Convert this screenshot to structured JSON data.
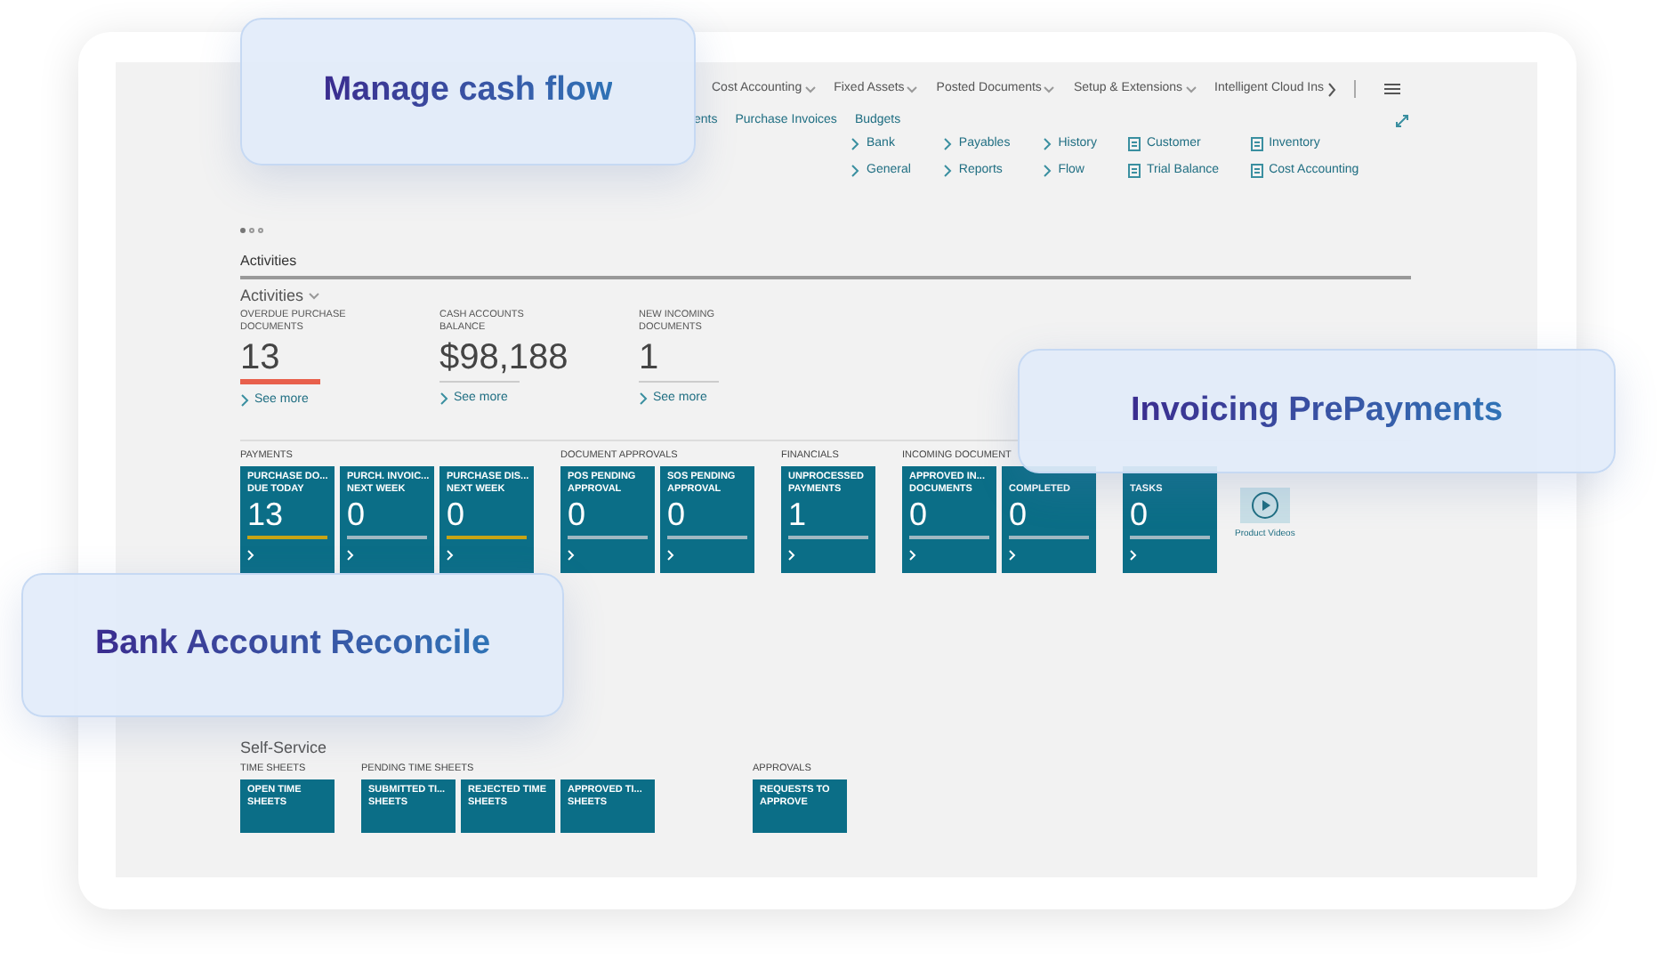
{
  "nav": {
    "menus": [
      "Cost Accounting",
      "Fixed Assets",
      "Posted Documents",
      "Setup & Extensions"
    ],
    "overflow_menu": "Intelligent Cloud Ins"
  },
  "actions": [
    "ents",
    "Purchase Invoices",
    "Budgets"
  ],
  "link_columns": [
    {
      "kind": "chevron",
      "links": [
        "Bank",
        "General"
      ]
    },
    {
      "kind": "chevron",
      "links": [
        "Payables",
        "Reports"
      ]
    },
    {
      "kind": "chevron",
      "links": [
        "History",
        "Flow"
      ]
    },
    {
      "kind": "report",
      "links": [
        "Customer",
        "Trial Balance"
      ]
    },
    {
      "kind": "report",
      "links": [
        "Inventory",
        "Cost Accounting"
      ]
    }
  ],
  "carousel": [
    {
      "selected": true
    },
    {
      "selected": false
    },
    {
      "selected": false
    }
  ],
  "section_title": "Activities",
  "activities": {
    "title": "Activities",
    "kpis": [
      {
        "label": "OVERDUE PURCHASE DOCUMENTS",
        "value": "13",
        "alert": true,
        "link": "See more"
      },
      {
        "label": "CASH ACCOUNTS BALANCE",
        "value": "$98,188",
        "alert": false,
        "link": "See more"
      },
      {
        "label": "NEW INCOMING DOCUMENTS",
        "value": "1",
        "alert": false,
        "link": "See more"
      }
    ]
  },
  "cue_groups": [
    {
      "title": "PAYMENTS",
      "tiles": [
        {
          "lines": [
            "PURCHASE DO...",
            "DUE TODAY"
          ],
          "value": "13",
          "color": "#c8a415"
        },
        {
          "lines": [
            "PURCH. INVOIC...",
            "NEXT WEEK"
          ],
          "value": "0",
          "color": "#9fb8c2"
        },
        {
          "lines": [
            "PURCHASE DIS...",
            "NEXT WEEK"
          ],
          "value": "0",
          "color": "#c8a415"
        }
      ]
    },
    {
      "title": "DOCUMENT APPROVALS",
      "tiles": [
        {
          "lines": [
            "POS PENDING",
            "APPROVAL"
          ],
          "value": "0",
          "color": "#9fb8c2"
        },
        {
          "lines": [
            "SOS PENDING",
            "APPROVAL"
          ],
          "value": "0",
          "color": "#9fb8c2"
        }
      ]
    },
    {
      "title": "FINANCIALS",
      "tiles": [
        {
          "lines": [
            "UNPROCESSED",
            "PAYMENTS"
          ],
          "value": "1",
          "color": "#9fb8c2"
        }
      ]
    },
    {
      "title": "INCOMING DOCUMENT",
      "tiles": [
        {
          "lines": [
            "APPROVED IN...",
            "DOCUMENTS"
          ],
          "value": "0",
          "color": "#9fb8c2"
        },
        {
          "lines": [
            "COMPLETED"
          ],
          "value": "0",
          "color": "#9fb8c2"
        }
      ]
    },
    {
      "tiles": [
        {
          "lines": [
            "TASKS"
          ],
          "value": "0",
          "color": "#9fb8c2"
        }
      ]
    }
  ],
  "product_videos": "Product Videos",
  "self_service": {
    "title": "Self-Service",
    "groups": [
      {
        "title": "TIME SHEETS",
        "tiles": [
          [
            "OPEN TIME",
            "SHEETS"
          ]
        ]
      },
      {
        "title": "PENDING TIME SHEETS",
        "tiles": [
          [
            "SUBMITTED TI...",
            "SHEETS"
          ],
          [
            "REJECTED TIME",
            "SHEETS"
          ],
          [
            "APPROVED TI...",
            "SHEETS"
          ]
        ]
      },
      {
        "title": "APPROVALS",
        "tiles": [
          [
            "REQUESTS TO",
            "APPROVE"
          ]
        ]
      }
    ]
  },
  "callouts": [
    {
      "title": "Manage cash flow"
    },
    {
      "title": "Invoicing PrePayments"
    },
    {
      "title": "Bank Account Reconcile"
    }
  ]
}
